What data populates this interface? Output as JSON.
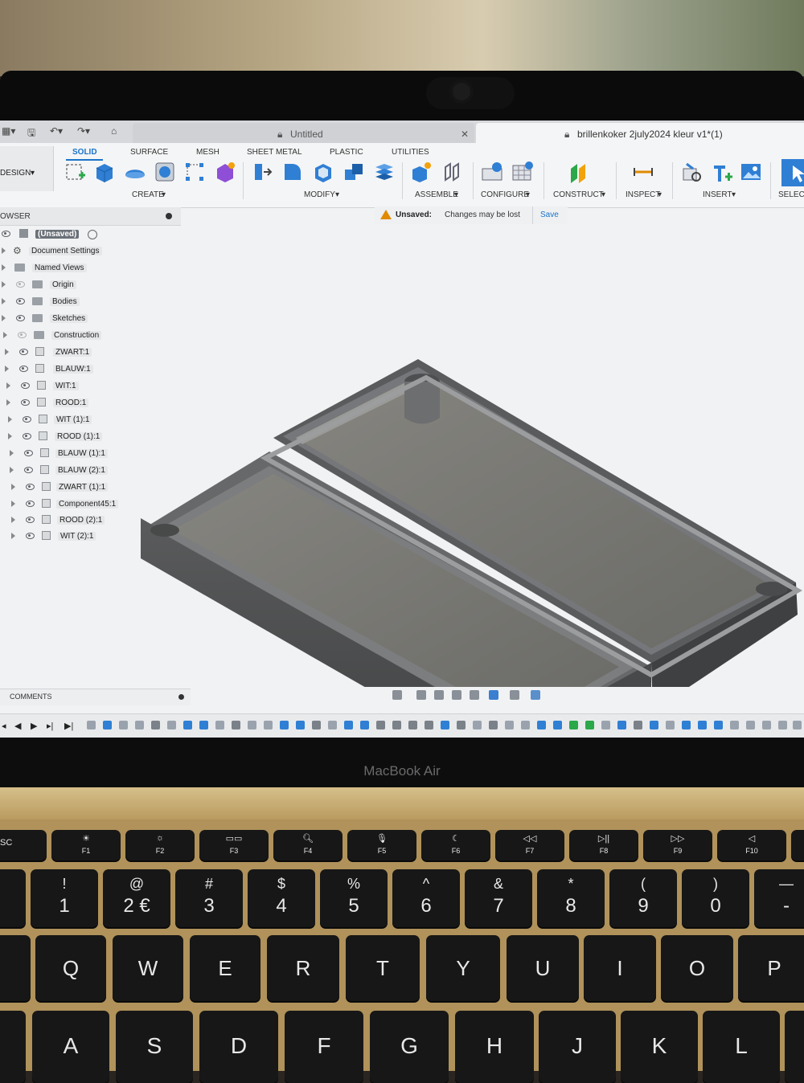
{
  "window": {
    "tab_inactive": "Untitled",
    "tab_active": "brillenkoker 2july2024 kleur v1*(1)"
  },
  "ribbon": {
    "workspace": "DESIGN",
    "tabs": [
      "SOLID",
      "SURFACE",
      "MESH",
      "SHEET METAL",
      "PLASTIC",
      "UTILITIES"
    ],
    "groups": {
      "create": "CREATE",
      "modify": "MODIFY",
      "assemble": "ASSEMBLE",
      "configure": "CONFIGURE",
      "construct": "CONSTRUCT",
      "inspect": "INSPECT",
      "insert": "INSERT",
      "select": "SELECT"
    }
  },
  "browser": {
    "title": "OWSER",
    "root": "(Unsaved)",
    "items": [
      "Document Settings",
      "Named Views",
      "Origin",
      "Bodies",
      "Sketches",
      "Construction",
      "ZWART:1",
      "BLAUW:1",
      "WIT:1",
      "ROOD:1",
      "WIT (1):1",
      "ROOD (1):1",
      "BLAUW (1):1",
      "BLAUW (2):1",
      "ZWART (1):1",
      "Component45:1",
      "ROOD (2):1",
      "WIT (2):1"
    ]
  },
  "notice": {
    "label": "Unsaved:",
    "message": "Changes may be lost",
    "action": "Save"
  },
  "comments": {
    "title": "COMMENTS"
  },
  "laptop": {
    "brand": "MacBook Air"
  },
  "keyboard": {
    "fn_row": [
      {
        "top": "☀",
        "bottom": "F1"
      },
      {
        "top": "☼",
        "bottom": "F2"
      },
      {
        "top": "▭▭",
        "bottom": "F3"
      },
      {
        "top": "🔍︎",
        "bottom": "F4"
      },
      {
        "top": "🎙︎",
        "bottom": "F5"
      },
      {
        "top": "☾",
        "bottom": "F6"
      },
      {
        "top": "◁◁",
        "bottom": "F7"
      },
      {
        "top": "▷||",
        "bottom": "F8"
      },
      {
        "top": "▷▷",
        "bottom": "F9"
      },
      {
        "top": "◁",
        "bottom": "F10"
      }
    ],
    "esc": "SC",
    "number_row": [
      {
        "top": "!",
        "bottom": "1"
      },
      {
        "top": "@",
        "bottom": "2 €"
      },
      {
        "top": "#",
        "bottom": "3"
      },
      {
        "top": "$",
        "bottom": "4"
      },
      {
        "top": "%",
        "bottom": "5"
      },
      {
        "top": "^",
        "bottom": "6"
      },
      {
        "top": "&",
        "bottom": "7"
      },
      {
        "top": "*",
        "bottom": "8"
      },
      {
        "top": "(",
        "bottom": "9"
      },
      {
        "top": ")",
        "bottom": "0"
      },
      {
        "top": "—",
        "bottom": "-"
      }
    ],
    "qwerty_row": [
      "Q",
      "W",
      "E",
      "R",
      "T",
      "Y",
      "U",
      "I",
      "O",
      "P"
    ],
    "home_row": [
      "A",
      "S",
      "D",
      "F",
      "G",
      "H",
      "J",
      "K",
      "L"
    ]
  },
  "colors": {
    "accent": "#1a73c9",
    "warning": "#e08a00",
    "model_gray": "#6f706e"
  }
}
